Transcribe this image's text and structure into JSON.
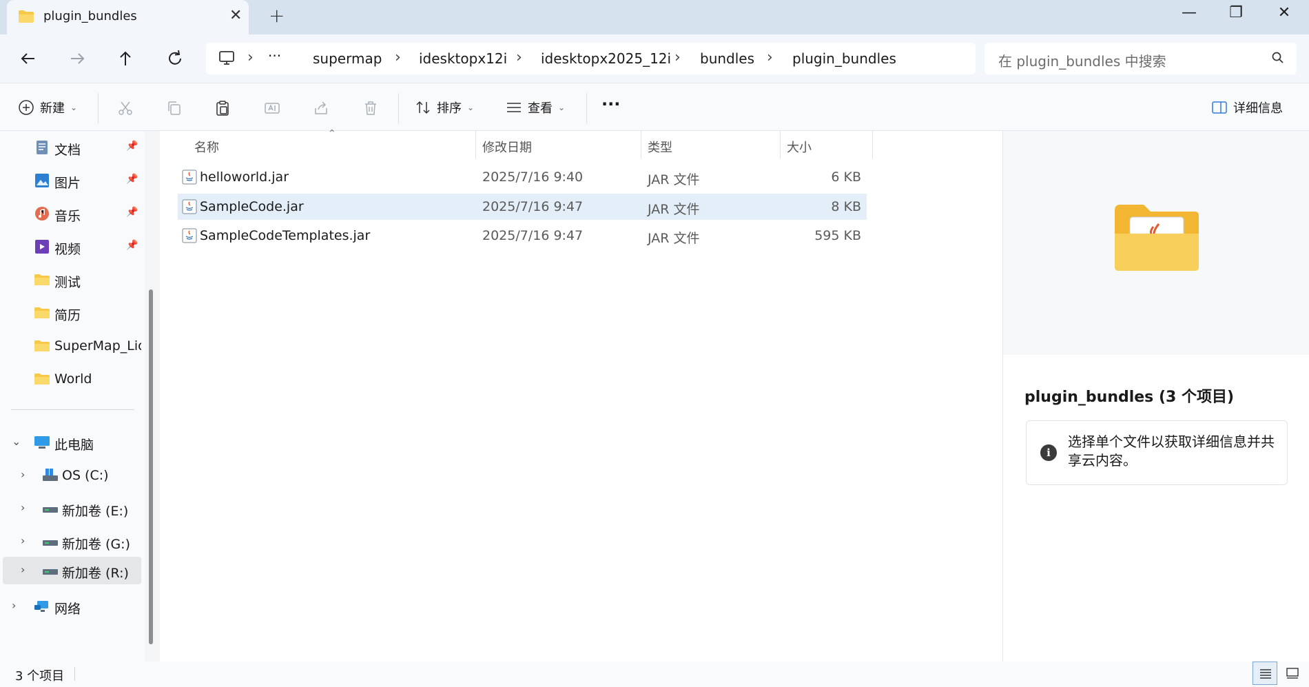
{
  "window": {
    "tab_title": "plugin_bundles",
    "new_tab_symbol": "+",
    "close_tab_symbol": "✕",
    "minimize_symbol": "—",
    "restore_symbol": "❐",
    "close_symbol": "✕"
  },
  "address": {
    "ellipsis": "···",
    "crumbs": [
      "supermap",
      "idesktopx12i",
      "idesktopx2025_12i",
      "bundles",
      "plugin_bundles"
    ]
  },
  "search": {
    "placeholder": "在 plugin_bundles 中搜索"
  },
  "toolbar": {
    "new_label": "新建",
    "sort_label": "排序",
    "view_label": "查看",
    "more_label": "···",
    "details_label": "详细信息"
  },
  "sidebar": {
    "quick": [
      {
        "label": "文档",
        "icon": "document-icon",
        "pinned": true
      },
      {
        "label": "图片",
        "icon": "pictures-icon",
        "pinned": true
      },
      {
        "label": "音乐",
        "icon": "music-icon",
        "pinned": true
      },
      {
        "label": "视频",
        "icon": "video-icon",
        "pinned": true
      },
      {
        "label": "测试",
        "icon": "folder-icon",
        "pinned": false
      },
      {
        "label": "简历",
        "icon": "folder-icon",
        "pinned": false
      },
      {
        "label": "SuperMap_License",
        "icon": "folder-icon",
        "pinned": false
      },
      {
        "label": "World",
        "icon": "folder-icon",
        "pinned": false
      }
    ],
    "this_pc": "此电脑",
    "drives": [
      {
        "label": "OS (C:)",
        "selected": false
      },
      {
        "label": "新加卷 (E:)",
        "selected": false
      },
      {
        "label": "新加卷 (G:)",
        "selected": false
      },
      {
        "label": "新加卷 (R:)",
        "selected": true
      }
    ],
    "network": "网络"
  },
  "files": {
    "columns": [
      "名称",
      "修改日期",
      "类型",
      "大小"
    ],
    "rows": [
      {
        "name": "helloworld.jar",
        "date": "2025/7/16 9:40",
        "type": "JAR 文件",
        "size": "6 KB",
        "selected": false
      },
      {
        "name": "SampleCode.jar",
        "date": "2025/7/16 9:47",
        "type": "JAR 文件",
        "size": "8 KB",
        "selected": true
      },
      {
        "name": "SampleCodeTemplates.jar",
        "date": "2025/7/16 9:47",
        "type": "JAR 文件",
        "size": "595 KB",
        "selected": false
      }
    ]
  },
  "details": {
    "title": "plugin_bundles (3 个项目)",
    "info_icon": "i",
    "info_text": "选择单个文件以获取详细信息并共享云内容。"
  },
  "status": {
    "count": "3 个项目"
  },
  "colors": {
    "titlebar": "#d6e3ef",
    "selection": "#e3eef9",
    "folder_yellow": "#f7c948",
    "accent_blue": "#2f7bd6"
  }
}
